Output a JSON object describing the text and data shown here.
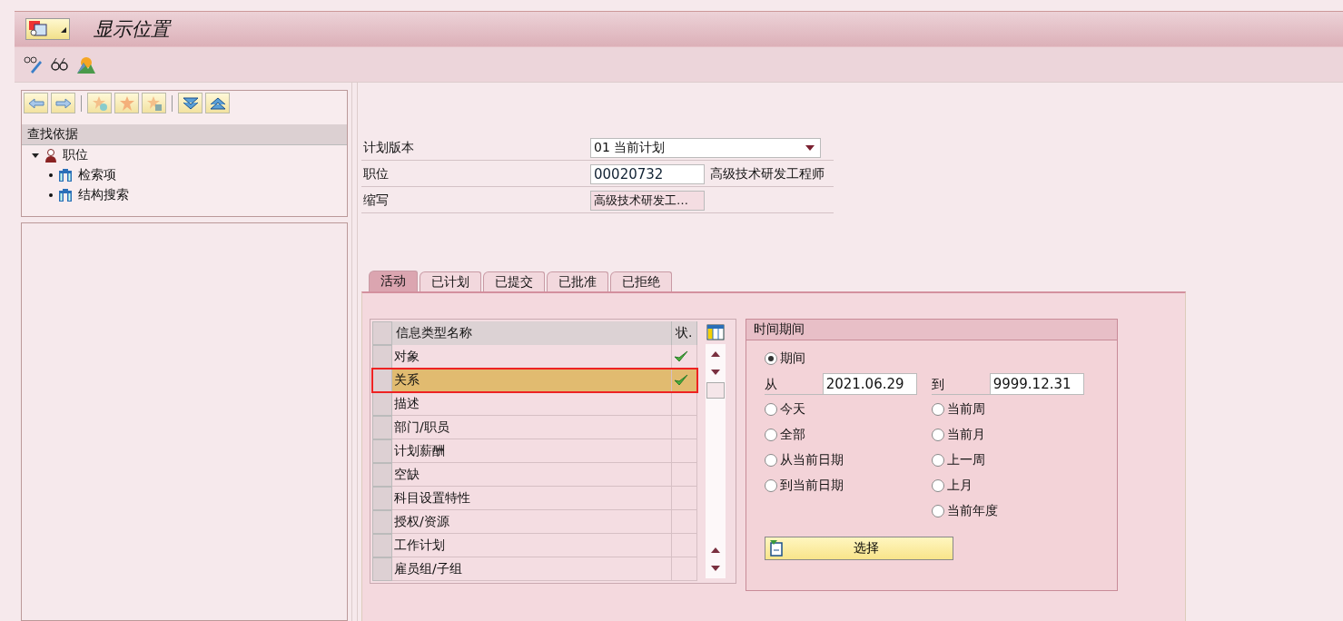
{
  "window": {
    "title": "显示位置"
  },
  "nav": {
    "header": "查找依据",
    "tree": [
      {
        "label": "职位",
        "expanded": true,
        "kind": "person",
        "children": [
          {
            "label": "检索项",
            "kind": "binoculars"
          },
          {
            "label": "结构搜索",
            "kind": "binoculars"
          }
        ]
      }
    ]
  },
  "form": [
    {
      "label": "计划版本",
      "kind": "dropdown",
      "value": "01 当前计划"
    },
    {
      "label": "职位",
      "kind": "input",
      "value": "00020732",
      "text": "高级技术研发工程师"
    },
    {
      "label": "缩写",
      "kind": "readonly",
      "value": "高级技术研发工…"
    }
  ],
  "tabs": [
    {
      "label": "活动",
      "selected": true
    },
    {
      "label": "已计划",
      "selected": false
    },
    {
      "label": "已提交",
      "selected": false
    },
    {
      "label": "已批准",
      "selected": false
    },
    {
      "label": "已拒绝",
      "selected": false
    }
  ],
  "table": {
    "columns": [
      "信息类型名称",
      "状."
    ],
    "rows": [
      {
        "name": "对象",
        "ok": true,
        "selected": false
      },
      {
        "name": "关系",
        "ok": true,
        "selected": true
      },
      {
        "name": "描述",
        "ok": false,
        "selected": false
      },
      {
        "name": "部门/职员",
        "ok": false,
        "selected": false
      },
      {
        "name": "计划薪酬",
        "ok": false,
        "selected": false
      },
      {
        "name": "空缺",
        "ok": false,
        "selected": false
      },
      {
        "name": "科目设置特性",
        "ok": false,
        "selected": false
      },
      {
        "name": "授权/资源",
        "ok": false,
        "selected": false
      },
      {
        "name": "工作计划",
        "ok": false,
        "selected": false
      },
      {
        "name": "雇员组/子组",
        "ok": false,
        "selected": false
      }
    ]
  },
  "time_period": {
    "title": "时间期间",
    "period": {
      "label": "期间",
      "selected": true
    },
    "from_label": "从",
    "from": "2021.06.29",
    "to_label": "到",
    "to": "9999.12.31",
    "left_options": [
      {
        "label": "今天",
        "selected": false
      },
      {
        "label": "全部",
        "selected": false
      },
      {
        "label": "从当前日期",
        "selected": false
      },
      {
        "label": "到当前日期",
        "selected": false
      }
    ],
    "right_options": [
      {
        "label": "当前周",
        "selected": false
      },
      {
        "label": "当前月",
        "selected": false
      },
      {
        "label": "上一周",
        "selected": false
      },
      {
        "label": "上月",
        "selected": false
      },
      {
        "label": "当前年度",
        "selected": false
      }
    ],
    "button": "选择"
  }
}
